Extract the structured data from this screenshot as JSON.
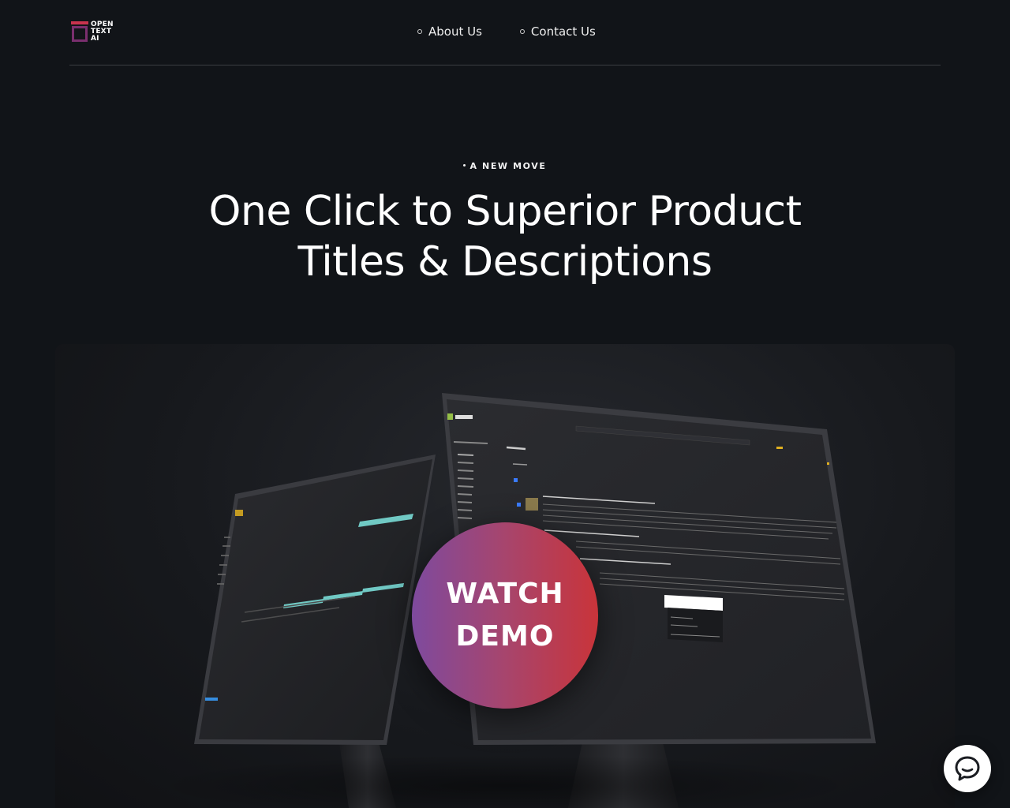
{
  "logo": {
    "line1": "OPEN",
    "line2": "TEXT",
    "line3": "AI"
  },
  "nav": [
    {
      "label": "About Us"
    },
    {
      "label": "Contact Us"
    }
  ],
  "hero": {
    "eyebrow": "A NEW MOVE",
    "title_line1": "One Click to Superior Product",
    "title_line2": "Titles & Descriptions"
  },
  "cta": {
    "line1": "WATCH",
    "line2": "DEMO"
  },
  "icons": {
    "chat": "chat-bubble-icon"
  },
  "colors": {
    "background": "#111418",
    "cta_gradient_start": "#7e4a9e",
    "cta_gradient_end": "#c9343a",
    "logo_accent": "#c8334e"
  }
}
